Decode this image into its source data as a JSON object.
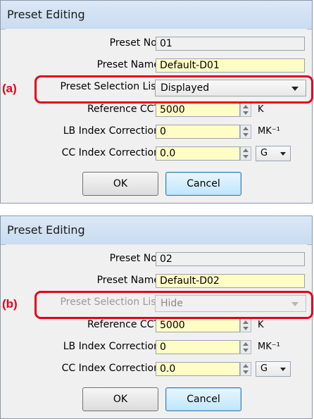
{
  "dialogs": [
    {
      "title": "Preset Editing",
      "tag": "(a)",
      "preset_no_label": "Preset No.",
      "preset_no_value": "01",
      "preset_name_label": "Preset Name",
      "preset_name_value": "Default-D01",
      "selection_list_label": "Preset Selection List",
      "selection_list_value": "Displayed",
      "reference_cct_label": "Reference CCT",
      "reference_cct_value": "5000",
      "reference_cct_unit": "K",
      "lb_index_label": "LB Index Correction",
      "lb_index_value": "0",
      "lb_index_unit": "MK⁻¹",
      "cc_index_label": "CC Index Correction",
      "cc_index_value": "0.0",
      "cc_index_unit": "G",
      "ok_label": "OK",
      "cancel_label": "Cancel"
    },
    {
      "title": "Preset Editing",
      "tag": "(b)",
      "preset_no_label": "Preset No.",
      "preset_no_value": "02",
      "preset_name_label": "Preset Name",
      "preset_name_value": "Default-D02",
      "selection_list_label": "Preset Selection List",
      "selection_list_value": "Hide",
      "reference_cct_label": "Reference CCT",
      "reference_cct_value": "5000",
      "reference_cct_unit": "K",
      "lb_index_label": "LB Index Correction",
      "lb_index_value": "0",
      "lb_index_unit": "MK⁻¹",
      "cc_index_label": "CC Index Correction",
      "cc_index_value": "0.0",
      "cc_index_unit": "G",
      "ok_label": "OK",
      "cancel_label": "Cancel"
    }
  ],
  "colors": {
    "highlight": "#e4001c",
    "field_yellow": "#fffdc6",
    "titlebar": "#d3e3f5"
  }
}
